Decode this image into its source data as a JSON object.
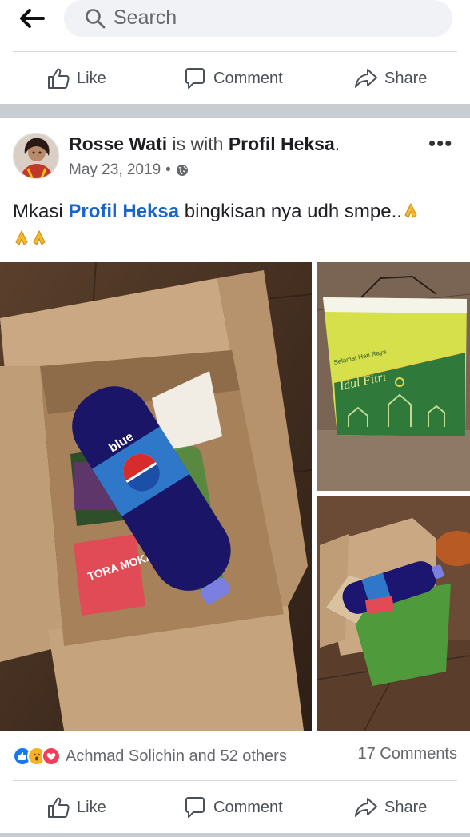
{
  "search": {
    "placeholder": "Search"
  },
  "actions_top": {
    "like": "Like",
    "comment": "Comment",
    "share": "Share"
  },
  "post": {
    "author": "Rosse Wati",
    "with_text": "is with",
    "tagged": "Profil Heksa",
    "period": ".",
    "date": "May 23, 2019",
    "sep": "•",
    "privacy_icon": "globe-icon",
    "text_before": "Mkasi ",
    "text_tag": "Profil Heksa",
    "text_after": " bingkisan nya udh smpe..",
    "emoji": "folded-hands"
  },
  "photo_texts": {
    "bottle_label": "blue",
    "card_text": "TORA MOKA",
    "bag_greeting": "Selamat Hari Raya",
    "bag_title": "Idul Fitri"
  },
  "reactions": {
    "summary": "Achmad Solichin and 52 others",
    "comments": "17 Comments",
    "types": [
      "like",
      "wow",
      "love"
    ]
  },
  "actions_bottom": {
    "like": "Like",
    "comment": "Comment",
    "share": "Share"
  },
  "colors": {
    "link": "#1a65c9",
    "muted": "#65676b",
    "separator": "#c9ccd1",
    "like_blue": "#1877f2",
    "love_red": "#f33e58",
    "wow_yellow": "#f7b125"
  }
}
